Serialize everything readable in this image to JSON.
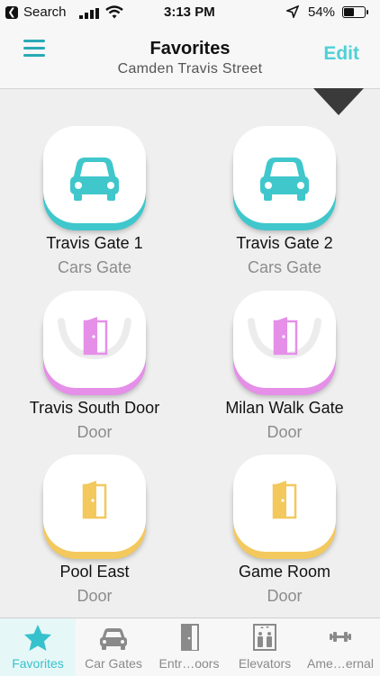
{
  "status_bar": {
    "back_app": "Search",
    "time": "3:13 PM",
    "battery_percent": "54%",
    "battery_level": 0.54
  },
  "header": {
    "title": "Favorites",
    "subtitle": "Camden Travis Street",
    "edit_label": "Edit"
  },
  "colors": {
    "accent": "#4fd0d6",
    "cars": "#3fc7cc",
    "door_pink": "#e58fe8",
    "door_yellow": "#f3c85d"
  },
  "tiles": [
    {
      "name": "Travis Gate 1",
      "type": "Cars Gate",
      "icon": "car-icon"
    },
    {
      "name": "Travis Gate 2",
      "type": "Cars Gate",
      "icon": "car-icon"
    },
    {
      "name": "Travis South Door",
      "type": "Door",
      "icon": "door-icon"
    },
    {
      "name": "Milan Walk Gate",
      "type": "Door",
      "icon": "door-icon"
    },
    {
      "name": "Pool East",
      "type": "Door",
      "icon": "door-icon"
    },
    {
      "name": "Game Room",
      "type": "Door",
      "icon": "door-icon"
    }
  ],
  "tabbar": {
    "items": [
      {
        "label": "Favorites",
        "icon": "star-icon",
        "active": true
      },
      {
        "label": "Car Gates",
        "icon": "car-icon"
      },
      {
        "label": "Entr…oors",
        "icon": "door-icon"
      },
      {
        "label": "Elevators",
        "icon": "elevator-icon"
      },
      {
        "label": "Ame…ernal",
        "icon": "dumbbell-icon"
      }
    ]
  }
}
